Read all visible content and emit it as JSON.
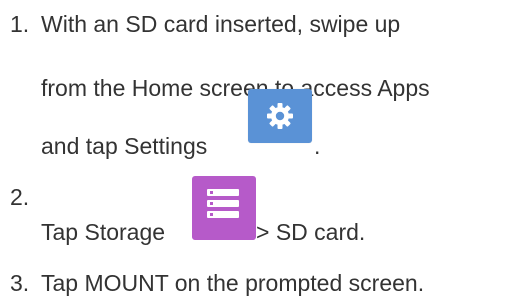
{
  "steps": [
    {
      "number": "1.",
      "line1": "With an SD card inserted, swipe up",
      "line2": "from the Home screen to access Apps",
      "line3_before_icon": "and tap Settings",
      "line3_after_icon": ".",
      "icon": "settings-gear-icon",
      "icon_color": "#5a92d6"
    },
    {
      "number": "2.",
      "text_before_icon": "Tap Storage",
      "text_after_icon": "> SD card.",
      "icon": "storage-icon",
      "icon_color": "#b65ac9"
    },
    {
      "number": "3.",
      "text": "Tap MOUNT on the prompted screen."
    }
  ],
  "text_color": "#333333"
}
